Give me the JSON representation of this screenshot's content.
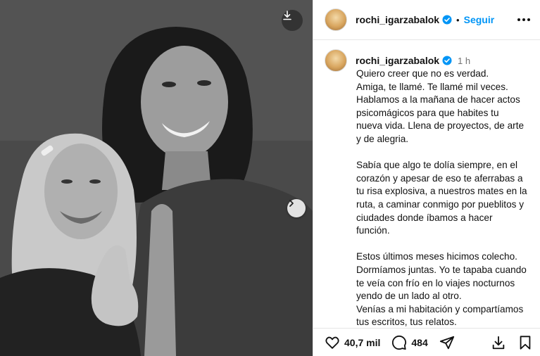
{
  "post": {
    "username": "rochi_igarzabalok",
    "follow_label": "Seguir",
    "dot": "•",
    "time_ago": "1 h",
    "caption": "Quiero creer que no es verdad.\nAmiga, te llamé. Te llamé mil veces.\nHablamos a la mañana de hacer actos\npsicomágicos para que habites tu\nnueva vida. Llena de proyectos, de arte\ny de alegria.\n\nSabía que algo te dolía siempre, en el\ncorazón y apesar de eso te aferrabas a\ntu risa explosiva, a nuestros mates en la\nruta, a caminar conmigo por pueblitos y\nciudades donde íbamos a hacer\nfunción.\n\nEstos últimos meses hicimos colecho.\nDormíamos juntas. Yo te tapaba cuando\nte veía con frío en lo viajes nocturnos\nyendo de un lado al otro.\nVenías a mi habitación y compartíamos\ntus escritos, tus relatos.",
    "likes": "40,7 mil",
    "comments": "484"
  },
  "icons": {
    "download": "download-icon",
    "next": "chevron-right-icon",
    "verified": "verified-badge-icon",
    "more": "more-options-icon",
    "like": "heart-icon",
    "comment": "comment-icon",
    "share": "share-icon",
    "save": "download-icon",
    "bookmark": "bookmark-icon"
  },
  "colors": {
    "accent": "#0095f6",
    "text": "#111111",
    "muted": "#737373",
    "divider": "#e6e6e6"
  }
}
